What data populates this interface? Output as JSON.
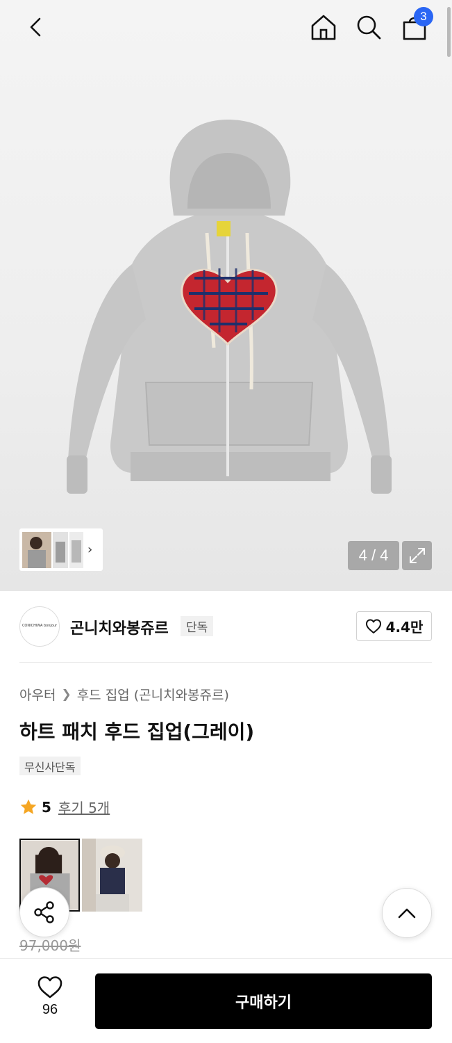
{
  "header": {
    "back_icon": "chevron-left-icon",
    "home_icon": "home-icon",
    "search_icon": "search-icon",
    "cart_icon": "shopping-bag-icon",
    "cart_count": "3",
    "cart_badge_color": "#2a66f4"
  },
  "gallery": {
    "counter": "4 / 4",
    "expand_icon": "expand-icon",
    "thumb_chevron": "›"
  },
  "brand": {
    "logo_text": "CONICHIWA bonjour",
    "name": "곤니치와봉쥬르",
    "tag": "단독",
    "likes": "4.4만"
  },
  "product": {
    "breadcrumb": [
      "아우터",
      "후드 집업 (곤니치와봉쥬르)"
    ],
    "title": "하트 패치 후드 집업(그레이)",
    "exclusive_tag": "무신사단독",
    "rating": "5",
    "review_link": "후기 5개",
    "original_price": "97,000원"
  },
  "bottom_bar": {
    "wish_count": "96",
    "buy_label": "구매하기"
  },
  "colors": {
    "accent_star": "#f5a623",
    "buy_button": "#000000"
  }
}
